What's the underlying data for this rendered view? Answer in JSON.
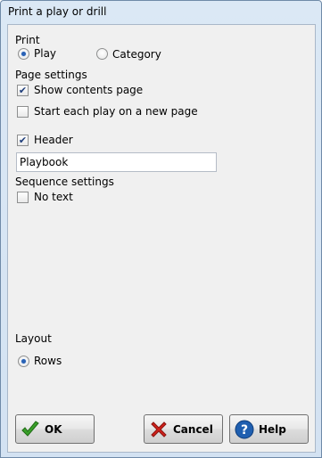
{
  "window": {
    "title": "Print a play or drill"
  },
  "print_group": {
    "label": "Print",
    "options": [
      {
        "label": "Play",
        "selected": true
      },
      {
        "label": "Category",
        "selected": false
      }
    ]
  },
  "page_settings": {
    "label": "Page settings",
    "show_contents": {
      "label": "Show contents page",
      "checked": true
    },
    "new_page": {
      "label": "Start each play on a new page",
      "checked": false
    }
  },
  "header": {
    "label": "Header",
    "checked": true,
    "value": "Playbook"
  },
  "sequence_settings": {
    "label": "Sequence settings",
    "no_text": {
      "label": "No text",
      "checked": false
    }
  },
  "layout": {
    "label": "Layout",
    "option": {
      "label": "Rows",
      "selected": true
    }
  },
  "buttons": {
    "ok": {
      "label": "OK",
      "icon": "green-checkmark-icon",
      "color": "#3aa02a"
    },
    "cancel": {
      "label": "Cancel",
      "icon": "red-x-icon",
      "color": "#d0201a"
    },
    "help": {
      "label": "Help",
      "icon": "blue-question-icon",
      "color": "#1f5fb0"
    }
  }
}
